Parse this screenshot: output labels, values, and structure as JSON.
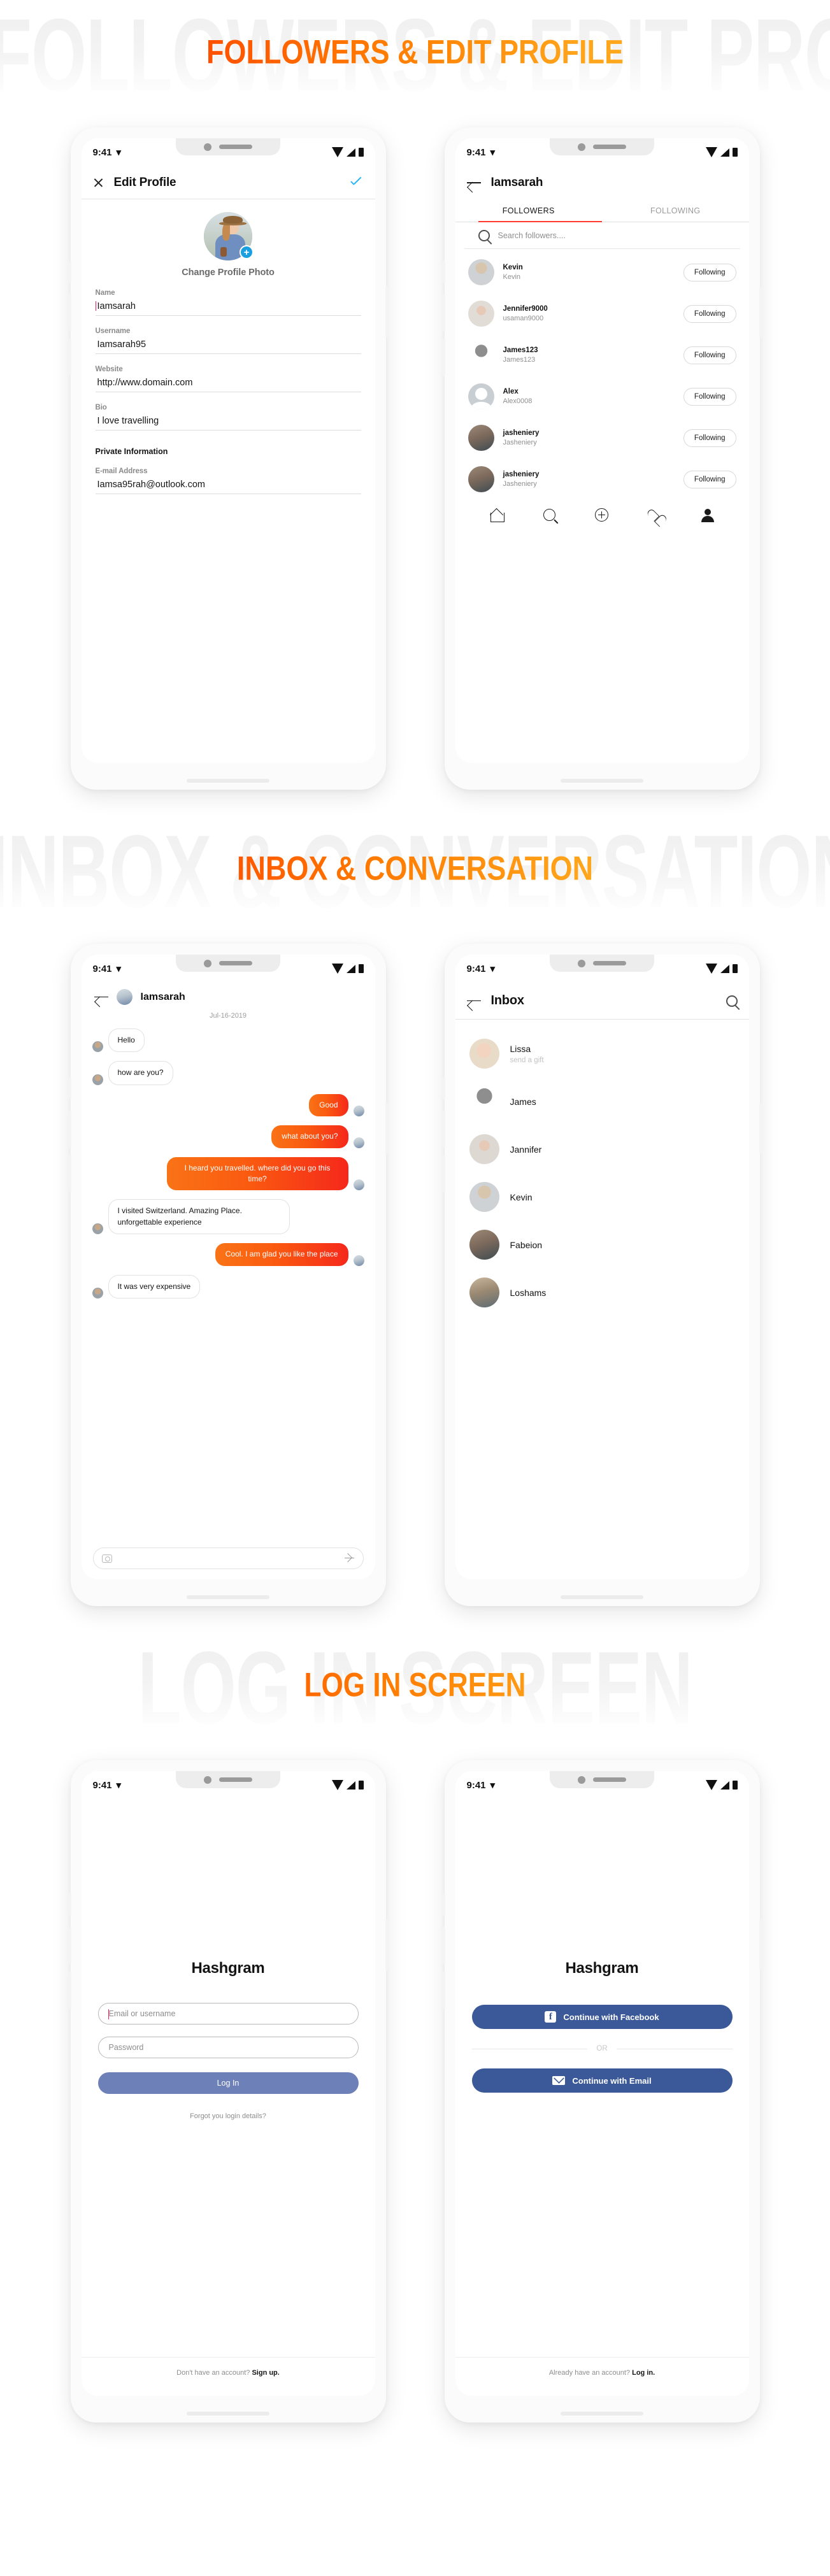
{
  "sections": [
    {
      "id": "followers",
      "title": "FOLLOWERS & EDIT PROFILE",
      "ghost": "FOLLOWERS & EDIT PROFILE"
    },
    {
      "id": "inbox",
      "title": "INBOX & CONVERSATION",
      "ghost": "INBOX & CONVERSATION"
    },
    {
      "id": "login",
      "title": "LOG IN SCREEN",
      "ghost": "LOG IN SCREEN"
    }
  ],
  "status_bar": {
    "time": "9:41",
    "wifi_icon": "wifi-icon",
    "signal_icon": "signal-icon",
    "battery_icon": "battery-icon"
  },
  "edit_profile": {
    "close_label": "close-icon",
    "title": "Edit Profile",
    "confirm_label": "check-icon",
    "change_photo": "Change Profile Photo",
    "fields": [
      {
        "label": "Name",
        "value": "Iamsarah",
        "caret": true
      },
      {
        "label": "Username",
        "value": "Iamsarah95",
        "caret": false
      },
      {
        "label": "Website",
        "value": "http://www.domain.com",
        "caret": false
      },
      {
        "label": "Bio",
        "value": "I love travelling",
        "caret": false
      }
    ],
    "private_section": "Private Information",
    "private_fields": [
      {
        "label": "E-mail Address",
        "value": "Iamsa95rah@outlook.com",
        "caret": false
      }
    ]
  },
  "followers_screen": {
    "title": "Iamsarah",
    "tabs": [
      {
        "label": "FOLLOWERS",
        "active": true
      },
      {
        "label": "FOLLOWING",
        "active": false
      }
    ],
    "search_placeholder": "Search followers....",
    "rows": [
      {
        "name": "Kevin",
        "handle": "Kevin",
        "action": "Following",
        "avatar": "man-glasses"
      },
      {
        "name": "Jennifer9000",
        "handle": "usaman9000",
        "action": "Following",
        "avatar": "woman-pink"
      },
      {
        "name": "James123",
        "handle": "James123",
        "action": "Following",
        "avatar": "man-bw"
      },
      {
        "name": "Alex",
        "handle": "Alex0008",
        "action": "Following",
        "avatar": "placeholder"
      },
      {
        "name": "jasheniery",
        "handle": "Jasheniery",
        "action": "Following",
        "avatar": "girl-street"
      },
      {
        "name": "jasheniery",
        "handle": "Jasheniery",
        "action": "Following",
        "avatar": "girl-street"
      }
    ],
    "tabbar": [
      "home-icon",
      "search-icon",
      "add-post-icon",
      "heart-icon",
      "profile-icon"
    ]
  },
  "conversation": {
    "title": "Iamsarah",
    "date": "Jul-16-2019",
    "messages": [
      {
        "side": "in",
        "text": "Hello"
      },
      {
        "side": "in",
        "text": "how are you?"
      },
      {
        "side": "out",
        "text": "Good"
      },
      {
        "side": "out",
        "text": "what about you?"
      },
      {
        "side": "out",
        "text": "I heard you travelled. where did you go this time?"
      },
      {
        "side": "in",
        "text": "I visited Switzerland. Amazing Place. unforgettable experience"
      },
      {
        "side": "out",
        "text": "Cool. I am glad you like the place"
      },
      {
        "side": "in",
        "text": "It was very expensive"
      }
    ],
    "composer": {
      "camera_icon": "camera-icon",
      "send_icon": "send-icon"
    }
  },
  "inbox": {
    "title": "Inbox",
    "search_icon": "search-icon",
    "rows": [
      {
        "name": "Lissa",
        "sub": "send a gift",
        "avatar": "blonde-woman"
      },
      {
        "name": "James",
        "sub": "",
        "avatar": "man-bw"
      },
      {
        "name": "Jannifer",
        "sub": "",
        "avatar": "woman-pink"
      },
      {
        "name": "Kevin",
        "sub": "",
        "avatar": "man-glasses"
      },
      {
        "name": "Fabeion",
        "sub": "",
        "avatar": "girl-street"
      },
      {
        "name": "Loshams",
        "sub": "",
        "avatar": "woman-hat"
      }
    ]
  },
  "login": {
    "brand": "Hashgram",
    "email_placeholder": "Email or username",
    "password_placeholder": "Password",
    "submit_label": "Log In",
    "forgot_label": "Forgot you login details?",
    "bottom_prefix": "Don't have an account? ",
    "bottom_action": "Sign up."
  },
  "signup": {
    "brand": "Hashgram",
    "facebook_label": "Continue with Facebook",
    "facebook_icon": "facebook-icon",
    "or_label": "OR",
    "email_label": "Continue with Email",
    "email_icon": "envelope-icon",
    "bottom_prefix": "Already have an account? ",
    "bottom_action": "Log in."
  },
  "colors": {
    "accent_red": "#ff3b30",
    "gradient_start": "#ff0000",
    "gradient_end": "#ffb520",
    "bubble_start": "#f97316",
    "bubble_end": "#f5281b",
    "facebook_blue": "#3b5998",
    "login_button": "#6e80b8",
    "badge_blue": "#1a9fe0",
    "caret_pink": "#e8205a"
  }
}
